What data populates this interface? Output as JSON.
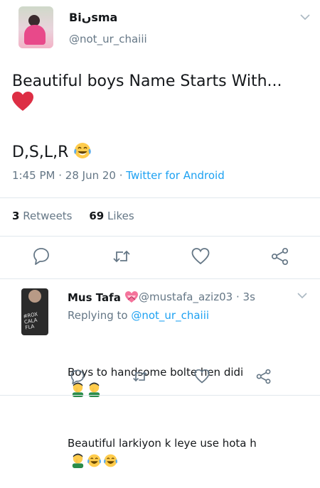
{
  "tweet": {
    "author_name": "Biںsma",
    "author_handle": "@not_ur_chaiii",
    "text": "Beautiful boys Name Starts With...",
    "second_line": "D,S,L,R",
    "time": "1:45 PM",
    "date": "28 Jun 20",
    "source": "Twitter for Android",
    "retweets_count": "3",
    "retweets_label": "Retweets",
    "likes_count": "69",
    "likes_label": "Likes"
  },
  "reply": {
    "author_name": "Mus Tafa",
    "author_handle": "@mustafa_aziz03",
    "age": "3s",
    "replying_label": "Replying to",
    "replying_to": "@not_ur_chaiii",
    "line1": "Boys to handsome bolte hen didi",
    "line2": "Beautiful larkiyon k leye use hota h",
    "avatar_text": "#ROX\nCALA\nFLA"
  },
  "icons": {
    "reply": "reply-icon",
    "retweet": "retweet-icon",
    "like": "heart-icon",
    "share": "share-icon",
    "menu": "chevron-down-icon"
  },
  "colors": {
    "link": "#1da1f2",
    "secondary_text": "#657786",
    "heart_emoji": "#dd2e44",
    "divider": "#e1e8ed"
  }
}
